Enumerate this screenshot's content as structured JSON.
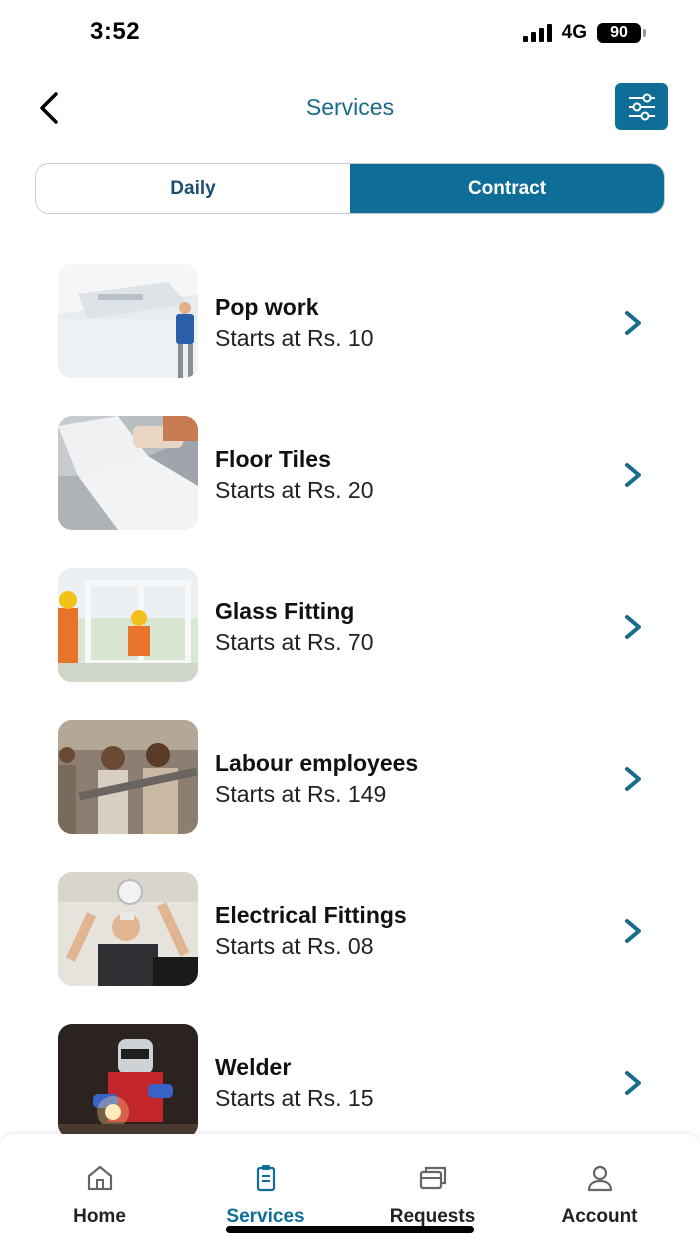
{
  "status_bar": {
    "time": "3:52",
    "network": "4G",
    "battery": "90"
  },
  "header": {
    "title": "Services"
  },
  "toggle": {
    "daily_label": "Daily",
    "contract_label": "Contract",
    "selected": "Contract"
  },
  "services": [
    {
      "name": "Pop work",
      "price": "Starts at Rs. 10"
    },
    {
      "name": "Floor Tiles",
      "price": "Starts at Rs. 20"
    },
    {
      "name": "Glass Fitting",
      "price": "Starts at Rs. 70"
    },
    {
      "name": "Labour employees",
      "price": "Starts at Rs. 149"
    },
    {
      "name": "Electrical Fittings",
      "price": "Starts at Rs. 08"
    },
    {
      "name": "Welder",
      "price": "Starts at Rs. 15"
    }
  ],
  "bottom_nav": {
    "items": [
      {
        "label": "Home",
        "icon": "home-icon"
      },
      {
        "label": "Services",
        "icon": "clipboard-icon"
      },
      {
        "label": "Requests",
        "icon": "cards-icon"
      },
      {
        "label": "Account",
        "icon": "user-icon"
      }
    ],
    "active": "Services"
  },
  "colors": {
    "accent": "#0f6e97",
    "title": "#1a6a8a",
    "chevron": "#1a6a8a"
  }
}
